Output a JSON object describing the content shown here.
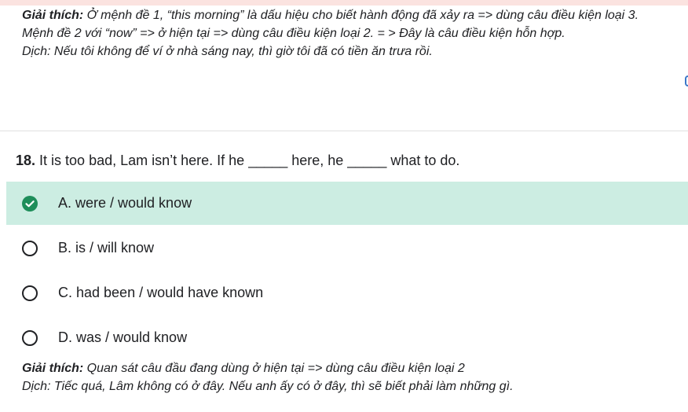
{
  "previous_explanation": {
    "label": "Giải thích:",
    "line1_rest": " Ở mệnh đề 1, “this morning” là dấu hiệu cho biết hành động đã xảy ra => dùng câu điều kiện loại 3.",
    "line2": "Mệnh đề 2 với “now” => ở hiện tại => dùng câu điều kiện loại 2. = > Đây là câu điều kiện hỗn hợp.",
    "line3": "Dịch: Nếu tôi không để ví ở nhà sáng nay, thì giờ tôi đã có tiền ăn trưa rồi."
  },
  "question": {
    "number": "18.",
    "text": "It is too bad, Lam isn’t here. If he _____ here, he _____ what to do."
  },
  "options": [
    {
      "label": "A. were / would know",
      "correct": true
    },
    {
      "label": "B. is / will know",
      "correct": false
    },
    {
      "label": "C. had been / would have known",
      "correct": false
    },
    {
      "label": "D. was / would know",
      "correct": false
    }
  ],
  "explanation": {
    "label": "Giải thích:",
    "line1_rest": " Quan sát câu đầu đang dùng ở hiện tại => dùng câu điều kiện loại 2",
    "line2": "Dịch: Tiếc quá, Lâm không có ở đây. Nếu anh ấy có ở đây, thì sẽ biết phải làm những gì."
  },
  "colors": {
    "correct_bg": "#ccede2",
    "check_green": "#1e8e5a",
    "top_strip": "#fbe3e0"
  },
  "icons": {
    "correct": "check-circle-icon",
    "unselected": "radio-empty-icon"
  }
}
